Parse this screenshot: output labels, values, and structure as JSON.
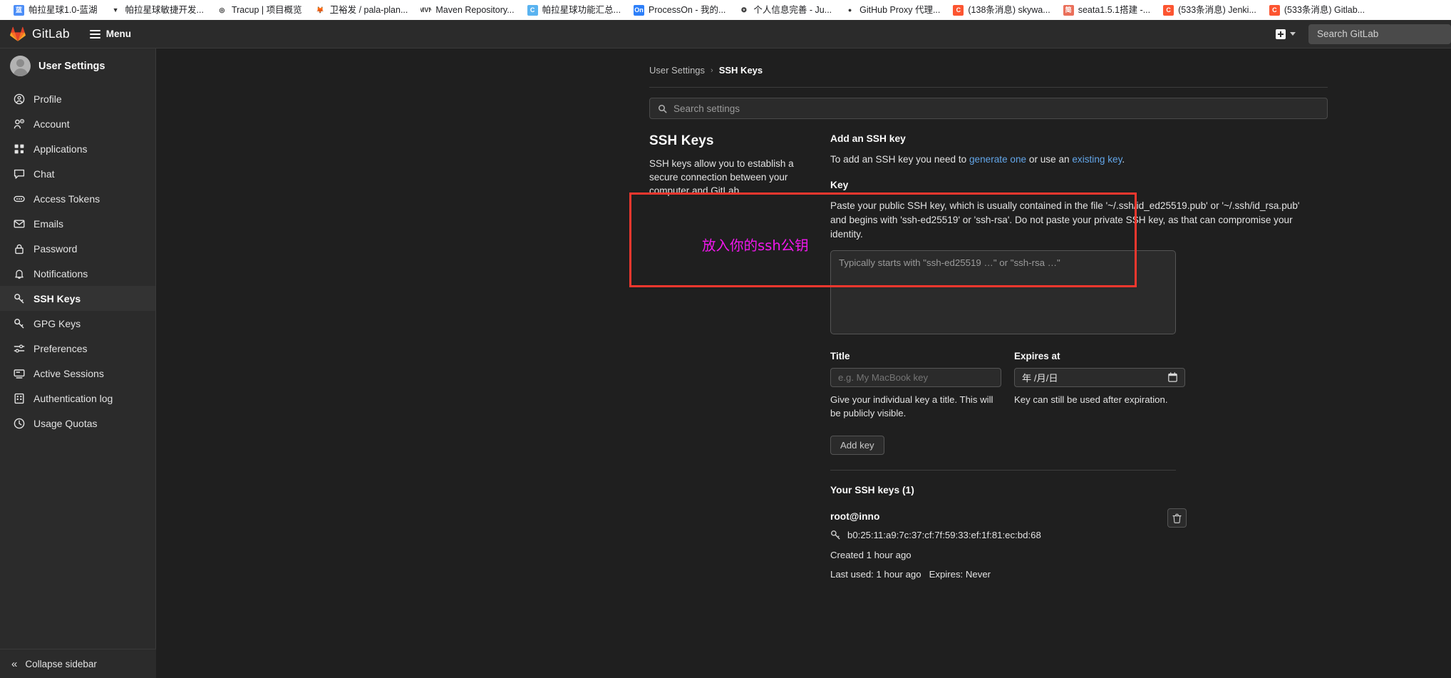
{
  "browser": {
    "bookmarks": [
      {
        "label": "帕拉星球1.0-蓝湖",
        "icon": "lanhu-icon",
        "color": "#4c8ef7",
        "glyph": "蓝"
      },
      {
        "label": "帕拉星球敏捷开发...",
        "icon": "vue-icon",
        "color": "#ffffff",
        "glyph": "▼"
      },
      {
        "label": "Tracup | 项目概览",
        "icon": "tracup-icon",
        "color": "#ffffff",
        "glyph": "◎"
      },
      {
        "label": "卫裕发 / pala-plan...",
        "icon": "gitlab-icon",
        "color": "#ffffff",
        "glyph": "🦊"
      },
      {
        "label": "Maven Repository...",
        "icon": "maven-icon",
        "color": "#ffffff",
        "glyph": "MVN"
      },
      {
        "label": "帕拉星球功能汇总...",
        "icon": "confluence-icon",
        "color": "#5ab3f0",
        "glyph": "C"
      },
      {
        "label": "ProcessOn - 我的...",
        "icon": "processon-icon",
        "color": "#2d7ff9",
        "glyph": "On"
      },
      {
        "label": "个人信息完善 - Ju...",
        "icon": "juejin-icon",
        "color": "#ffffff",
        "glyph": "❂"
      },
      {
        "label": "GitHub Proxy 代理...",
        "icon": "github-icon",
        "color": "#ffffff",
        "glyph": "●"
      },
      {
        "label": "(138条消息) skywa...",
        "icon": "csdn-icon",
        "color": "#fc5531",
        "glyph": "C"
      },
      {
        "label": "seata1.5.1搭建 -...",
        "icon": "jianshu-icon",
        "color": "#ea6f5a",
        "glyph": "简"
      },
      {
        "label": "(533条消息) Jenki...",
        "icon": "csdn-icon",
        "color": "#fc5531",
        "glyph": "C"
      },
      {
        "label": "(533条消息) Gitlab...",
        "icon": "csdn-icon",
        "color": "#fc5531",
        "glyph": "C"
      }
    ]
  },
  "navbar": {
    "brand": "GitLab",
    "menu_label": "Menu",
    "new_label": "",
    "search_placeholder": "Search GitLab"
  },
  "sidebar": {
    "header": "User Settings",
    "items": [
      {
        "label": "Profile",
        "icon": "user-circle-icon",
        "active": false
      },
      {
        "label": "Account",
        "icon": "account-gear-icon",
        "active": false
      },
      {
        "label": "Applications",
        "icon": "applications-icon",
        "active": false
      },
      {
        "label": "Chat",
        "icon": "chat-icon",
        "active": false
      },
      {
        "label": "Access Tokens",
        "icon": "token-icon",
        "active": false
      },
      {
        "label": "Emails",
        "icon": "envelope-icon",
        "active": false
      },
      {
        "label": "Password",
        "icon": "lock-icon",
        "active": false
      },
      {
        "label": "Notifications",
        "icon": "bell-icon",
        "active": false
      },
      {
        "label": "SSH Keys",
        "icon": "key-icon",
        "active": true
      },
      {
        "label": "GPG Keys",
        "icon": "key-icon",
        "active": false
      },
      {
        "label": "Preferences",
        "icon": "sliders-icon",
        "active": false
      },
      {
        "label": "Active Sessions",
        "icon": "monitor-icon",
        "active": false
      },
      {
        "label": "Authentication log",
        "icon": "log-list-icon",
        "active": false
      },
      {
        "label": "Usage Quotas",
        "icon": "clock-icon",
        "active": false
      }
    ],
    "collapse_label": "Collapse sidebar"
  },
  "breadcrumb": {
    "parent": "User Settings",
    "separator": "›",
    "current": "SSH Keys"
  },
  "search": {
    "placeholder": "Search settings",
    "value": ""
  },
  "section": {
    "title": "SSH Keys",
    "description": "SSH keys allow you to establish a secure connection between your computer and GitLab."
  },
  "add_key": {
    "heading": "Add an SSH key",
    "intro_prefix": "To add an SSH key you need to ",
    "link_generate": "generate one",
    "intro_middle": " or use an ",
    "link_existing": "existing key",
    "intro_suffix": ".",
    "key_label": "Key",
    "key_help": "Paste your public SSH key, which is usually contained in the file '~/.ssh/id_ed25519.pub' or '~/.ssh/id_rsa.pub' and begins with 'ssh-ed25519' or 'ssh-rsa'. Do not paste your private SSH key, as that can compromise your identity.",
    "key_placeholder": "Typically starts with \"ssh-ed25519 …\" or \"ssh-rsa …\"",
    "key_value": "",
    "title_label": "Title",
    "title_placeholder": "e.g. My MacBook key",
    "title_value": "",
    "title_hint": "Give your individual key a title. This will be publicly visible.",
    "expires_label": "Expires at",
    "expires_placeholder": "年 /月/日",
    "expires_hint": "Key can still be used after expiration.",
    "submit_label": "Add key"
  },
  "annotation": {
    "text": "放入你的ssh公钥",
    "text_color": "#f217ee",
    "box_color": "#f4372e"
  },
  "your_keys": {
    "heading": "Your SSH keys (1)",
    "entries": [
      {
        "name": "root@inno",
        "fingerprint": "b0:25:11:a9:7c:37:cf:7f:59:33:ef:1f:81:ec:bd:68",
        "created": "Created 1 hour ago",
        "last_used": "Last used: 1 hour ago",
        "expires": "Expires: Never"
      }
    ]
  },
  "colors": {
    "navbar_bg": "#2b2b2b",
    "page_bg": "#1f1f1f",
    "link": "#63a6e9",
    "accent_red": "#f4372e",
    "accent_magenta": "#f217ee"
  }
}
